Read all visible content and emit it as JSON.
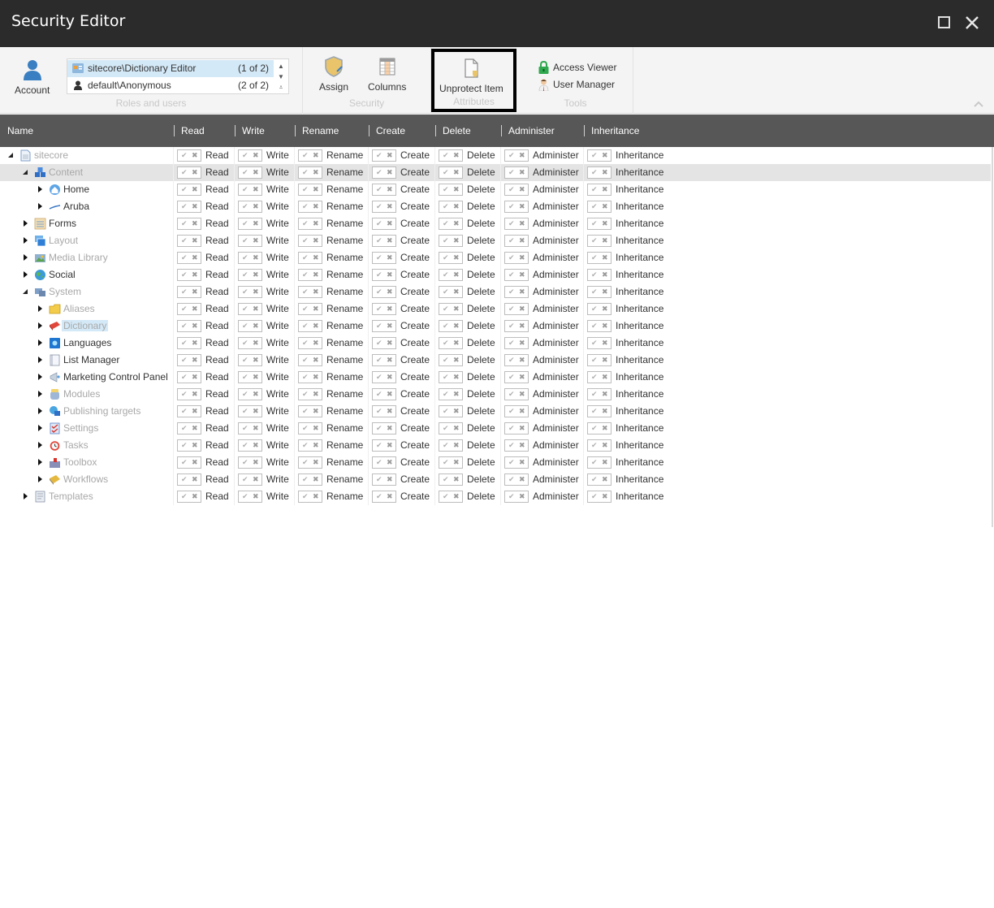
{
  "window": {
    "title": "Security Editor",
    "maximize_icon": "maximize-icon",
    "close_icon": "close-icon"
  },
  "ribbon": {
    "roles_group": {
      "label": "Roles and users",
      "account_button": {
        "label": "Account",
        "icon": "account-icon"
      },
      "roles": [
        {
          "name": "sitecore\\Dictionary Editor",
          "count": "(1 of 2)",
          "icon": "role-icon",
          "selected": true
        },
        {
          "name": "default\\Anonymous",
          "count": "(2 of 2)",
          "icon": "user-icon",
          "selected": false
        }
      ]
    },
    "security_group": {
      "label": "Security",
      "assign_button": {
        "label": "Assign",
        "icon": "shield-icon"
      },
      "columns_button": {
        "label": "Columns",
        "icon": "columns-icon"
      }
    },
    "attributes_group": {
      "label": "Attributes",
      "unprotect_button": {
        "label": "Unprotect Item",
        "icon": "unprotect-document-icon"
      }
    },
    "tools_group": {
      "label": "Tools",
      "access_viewer": {
        "label": "Access Viewer",
        "icon": "lock-icon"
      },
      "user_manager": {
        "label": "User Manager",
        "icon": "user-manager-icon"
      }
    }
  },
  "grid": {
    "columns": [
      "Name",
      "Read",
      "Write",
      "Rename",
      "Create",
      "Delete",
      "Administer",
      "Inheritance"
    ],
    "permissions": [
      "Read",
      "Write",
      "Rename",
      "Create",
      "Delete",
      "Administer",
      "Inheritance"
    ],
    "rows": [
      {
        "name": "sitecore",
        "level": 0,
        "expanded": true,
        "style": "dim",
        "icon": "document-icon",
        "highlight": false
      },
      {
        "name": "Content",
        "level": 1,
        "expanded": true,
        "style": "dim",
        "icon": "content-icon",
        "highlight": true
      },
      {
        "name": "Home",
        "level": 2,
        "expanded": false,
        "style": "dark",
        "icon": "home-icon",
        "highlight": false
      },
      {
        "name": "Aruba",
        "level": 2,
        "expanded": false,
        "style": "dark",
        "icon": "line-icon",
        "highlight": false
      },
      {
        "name": "Forms",
        "level": 1,
        "expanded": false,
        "style": "dark",
        "icon": "forms-icon",
        "highlight": false
      },
      {
        "name": "Layout",
        "level": 1,
        "expanded": false,
        "style": "dim",
        "icon": "layout-icon",
        "highlight": false
      },
      {
        "name": "Media Library",
        "level": 1,
        "expanded": false,
        "style": "dim",
        "icon": "media-library-icon",
        "highlight": false
      },
      {
        "name": "Social",
        "level": 1,
        "expanded": false,
        "style": "dark",
        "icon": "globe-icon",
        "highlight": false
      },
      {
        "name": "System",
        "level": 1,
        "expanded": true,
        "style": "dim",
        "icon": "system-icon",
        "highlight": false
      },
      {
        "name": "Aliases",
        "level": 2,
        "expanded": false,
        "style": "dim",
        "icon": "folder-icon",
        "highlight": false
      },
      {
        "name": "Dictionary",
        "level": 2,
        "expanded": false,
        "style": "dim",
        "icon": "dictionary-icon",
        "highlight": false,
        "selected": true
      },
      {
        "name": "Languages",
        "level": 2,
        "expanded": false,
        "style": "dark",
        "icon": "languages-icon",
        "highlight": false
      },
      {
        "name": "List Manager",
        "level": 2,
        "expanded": false,
        "style": "dark",
        "icon": "list-manager-icon",
        "highlight": false
      },
      {
        "name": "Marketing Control Panel",
        "level": 2,
        "expanded": false,
        "style": "dark",
        "icon": "megaphone-icon",
        "highlight": false
      },
      {
        "name": "Modules",
        "level": 2,
        "expanded": false,
        "style": "dim",
        "icon": "modules-icon",
        "highlight": false
      },
      {
        "name": "Publishing targets",
        "level": 2,
        "expanded": false,
        "style": "dim",
        "icon": "publishing-icon",
        "highlight": false
      },
      {
        "name": "Settings",
        "level": 2,
        "expanded": false,
        "style": "dim",
        "icon": "settings-icon",
        "highlight": false
      },
      {
        "name": "Tasks",
        "level": 2,
        "expanded": false,
        "style": "dim",
        "icon": "alarm-clock-icon",
        "highlight": false
      },
      {
        "name": "Toolbox",
        "level": 2,
        "expanded": false,
        "style": "dim",
        "icon": "toolbox-icon",
        "highlight": false
      },
      {
        "name": "Workflows",
        "level": 2,
        "expanded": false,
        "style": "dim",
        "icon": "workflow-icon",
        "highlight": false
      },
      {
        "name": "Templates",
        "level": 1,
        "expanded": false,
        "style": "dim",
        "icon": "templates-icon",
        "highlight": false
      }
    ]
  },
  "colors": {
    "titlebar": "#2b2b2b",
    "grid_header": "#575757",
    "selection": "#d4e9f7",
    "row_highlight": "#e4e4e4"
  }
}
